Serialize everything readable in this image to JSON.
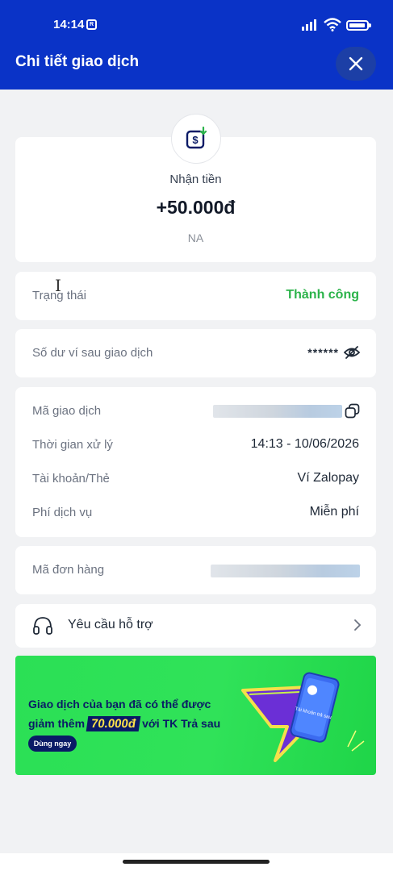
{
  "status_bar": {
    "time": "14:14",
    "rec_label": "R"
  },
  "header": {
    "title": "Chi tiết giao dịch"
  },
  "summary": {
    "type_label": "Nhận tiền",
    "amount": "+50.000đ",
    "note": "NA"
  },
  "status": {
    "label": "Trạng thái",
    "value": "Thành công"
  },
  "balance": {
    "label": "Số dư ví sau giao dịch",
    "masked_value": "******"
  },
  "details": {
    "transaction_id_label": "Mã giao dịch",
    "time_label": "Thời gian xử lý",
    "time_value": "14:13 - 10/06/2026",
    "account_label": "Tài khoản/Thẻ",
    "account_value": "Ví Zalopay",
    "fee_label": "Phí dịch vụ",
    "fee_value": "Miễn phí"
  },
  "order": {
    "label": "Mã đơn hàng"
  },
  "support": {
    "label": "Yêu cầu hỗ trợ"
  },
  "banner": {
    "line1": "Giao dịch của bạn đã có thể được",
    "line2_prefix": "giảm thêm",
    "highlight": "70.000đ",
    "line2_suffix": "với TK Trả sau",
    "cta": "Dùng ngay",
    "card_text": "Tài khoản trả sau"
  },
  "colors": {
    "header_bg": "#0a33c7",
    "success": "#2bb34a",
    "banner_bg": "#30e259",
    "banner_text": "#0a1a66"
  }
}
